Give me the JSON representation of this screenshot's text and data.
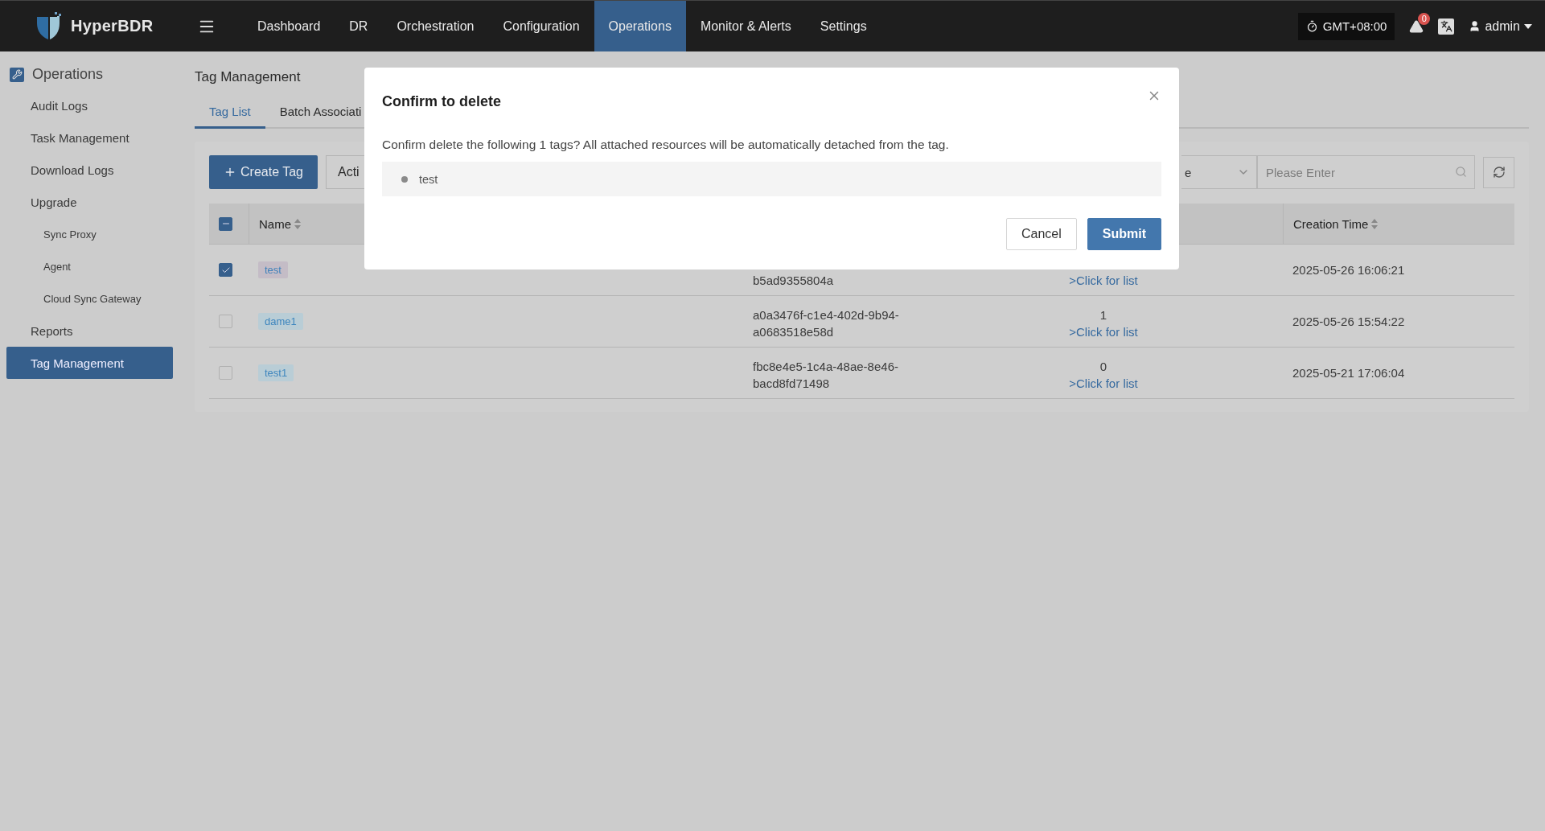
{
  "brand": {
    "name": "HyperBDR"
  },
  "nav": [
    {
      "label": "Dashboard",
      "selected": false
    },
    {
      "label": "DR",
      "selected": false
    },
    {
      "label": "Orchestration",
      "selected": false
    },
    {
      "label": "Configuration",
      "selected": false
    },
    {
      "label": "Operations",
      "selected": true
    },
    {
      "label": "Monitor & Alerts",
      "selected": false
    },
    {
      "label": "Settings",
      "selected": false
    }
  ],
  "header_right": {
    "timezone": "GMT+08:00",
    "alerts_count": "0",
    "user": "admin"
  },
  "sidebar": {
    "title": "Operations",
    "items": [
      {
        "label": "Audit Logs",
        "selected": false
      },
      {
        "label": "Task Management",
        "selected": false
      },
      {
        "label": "Download Logs",
        "selected": false
      },
      {
        "label": "Upgrade",
        "selected": false,
        "children": [
          {
            "label": "Sync Proxy",
            "selected": false
          },
          {
            "label": "Agent",
            "selected": false
          },
          {
            "label": "Cloud Sync Gateway",
            "selected": false
          }
        ]
      },
      {
        "label": "Reports",
        "selected": false
      },
      {
        "label": "Tag Management",
        "selected": true
      }
    ]
  },
  "page": {
    "title": "Tag Management",
    "tabs": [
      {
        "label": "Tag List",
        "selected": true
      },
      {
        "label": "Batch Associati",
        "selected": false
      }
    ],
    "toolbar": {
      "create_button": "Create Tag",
      "actions_button": "Acti",
      "filter_select": "e",
      "search": {
        "placeholder": "Please Enter"
      }
    },
    "table": {
      "header_indeterminate": true,
      "columns": [
        {
          "label": "Name",
          "sortable": true
        },
        {
          "label": "Creation Time",
          "sortable": true
        }
      ],
      "rows": [
        {
          "selected": true,
          "name": "test",
          "color": "#c4bcc6",
          "id": "b5ad9355804a",
          "link": ">Click for list",
          "created": "2025-05-26 16:06:21"
        },
        {
          "selected": false,
          "name": "dame1",
          "color": "#b9cdd6",
          "id": "a0a3476f-c1e4-402d-9b94-a0683518e58d",
          "count": "1",
          "link": ">Click for list",
          "created": "2025-05-26 15:54:22"
        },
        {
          "selected": false,
          "name": "test1",
          "color": "#b9cdd6",
          "id": "fbc8e4e5-1c4a-48ae-8e46-bacd8fd71498",
          "count": "0",
          "link": ">Click for list",
          "created": "2025-05-21 17:06:04"
        }
      ]
    }
  },
  "modal": {
    "title": "Confirm to delete",
    "message": "Confirm delete the following 1 tags? All attached resources will be automatically detached from the tag.",
    "items": [
      "test"
    ],
    "buttons": [
      {
        "label": "Cancel",
        "kind": "secondary"
      },
      {
        "label": "Submit",
        "kind": "primary"
      }
    ]
  }
}
